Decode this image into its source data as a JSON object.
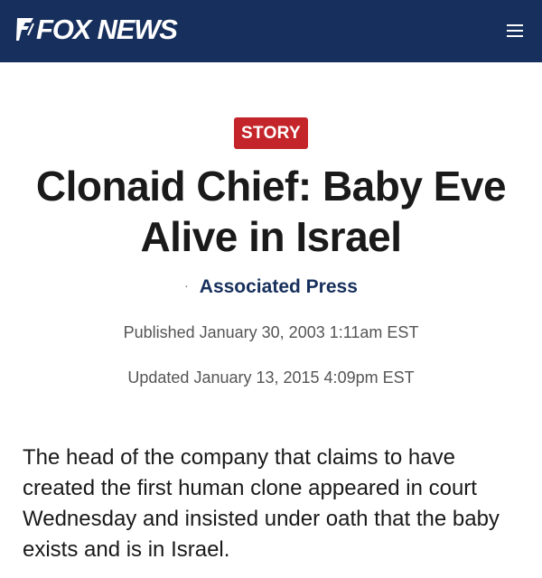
{
  "header": {
    "logo_text": "FOX NEWS",
    "logo_icon": "fox-news-logo-mark",
    "menu_icon": "hamburger-menu-icon",
    "background_color": "#162f5c"
  },
  "article": {
    "badge": "STORY",
    "badge_color": "#c4252a",
    "headline": "Clonaid Chief: Baby Eve Alive in Israel",
    "byline_separator": "·",
    "author": "Associated Press",
    "published": "Published January 30, 2003 1:11am EST",
    "updated": "Updated January 13, 2015 4:09pm EST",
    "body": "The head of the company that claims to have created the first human clone appeared in court Wednesday and insisted under oath that the baby exists and is in Israel."
  }
}
